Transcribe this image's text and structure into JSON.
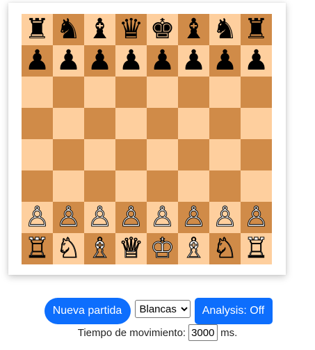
{
  "board": {
    "rows": [
      [
        "♜",
        "♞",
        "♝",
        "♛",
        "♚",
        "♝",
        "♞",
        "♜"
      ],
      [
        "♟",
        "♟",
        "♟",
        "♟",
        "♟",
        "♟",
        "♟",
        "♟"
      ],
      [
        "",
        "",
        "",
        "",
        "",
        "",
        "",
        ""
      ],
      [
        "",
        "",
        "",
        "",
        "",
        "",
        "",
        ""
      ],
      [
        "",
        "",
        "",
        "",
        "",
        "",
        "",
        ""
      ],
      [
        "",
        "",
        "",
        "",
        "",
        "",
        "",
        ""
      ],
      [
        "♙",
        "♙",
        "♙",
        "♙",
        "♙",
        "♙",
        "♙",
        "♙"
      ],
      [
        "♖",
        "♘",
        "♗",
        "♕",
        "♔",
        "♗",
        "♘",
        "♖"
      ]
    ],
    "light_color": "#fecf9e",
    "dark_color": "#d08b48"
  },
  "controls": {
    "new_game_label": "Nueva partida",
    "color_select_value": "Blancas",
    "analysis_label": "Analysis: Off",
    "accent_color": "#0d6efd"
  },
  "time": {
    "label": "Tiempo de movimiento:",
    "value": "3000",
    "unit": "ms."
  }
}
